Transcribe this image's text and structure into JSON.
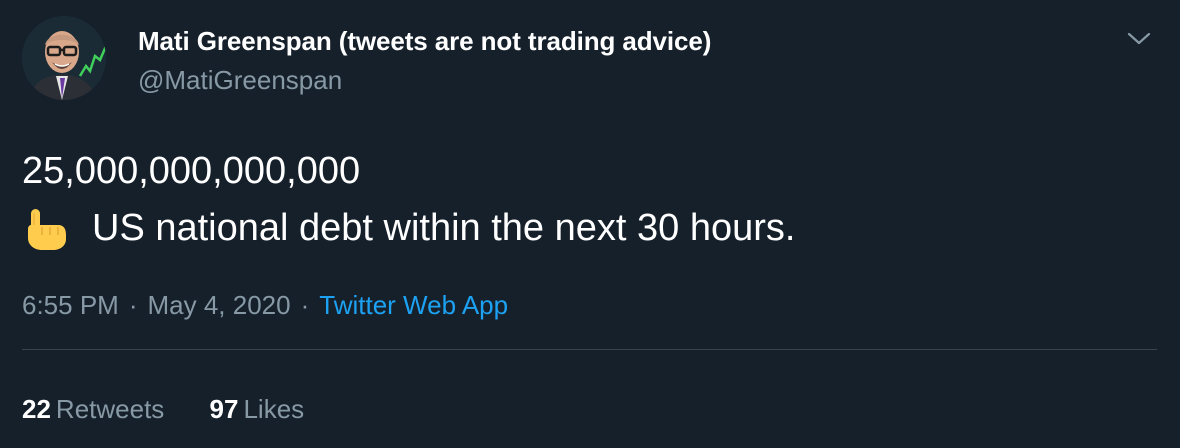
{
  "author": {
    "display_name": "Mati Greenspan (tweets are not trading advice)",
    "handle": "@MatiGreenspan"
  },
  "tweet": {
    "line1": "25,000,000,000,000",
    "line2_emoji_icon": "pointing-up-hand-icon",
    "line2": "US national debt within the next 30 hours."
  },
  "meta": {
    "time": "6:55 PM",
    "separator": "·",
    "date": "May 4, 2020",
    "source": "Twitter Web App"
  },
  "stats": {
    "retweets_count": "22",
    "retweets_label": "Retweets",
    "likes_count": "97",
    "likes_label": "Likes"
  },
  "colors": {
    "background": "#15202b",
    "secondary_text": "#8899a6",
    "link": "#1da1f2",
    "divider": "#38444d"
  }
}
